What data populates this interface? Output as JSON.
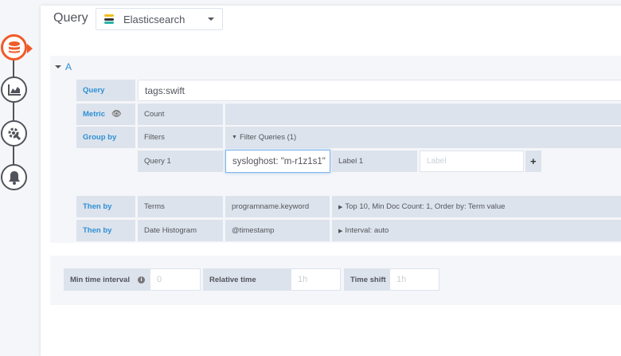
{
  "header": {
    "title": "Query",
    "datasource": "Elasticsearch"
  },
  "sidebar": {
    "icons": [
      "database-icon",
      "chart-area-icon",
      "settings-icon",
      "bell-icon"
    ],
    "accent": "#f05a28"
  },
  "query": {
    "ref": "A",
    "query_label": "Query",
    "query_value": "tags:swift",
    "metric_label": "Metric",
    "metric_value": "Count",
    "groupby_label": "Group by",
    "groupby_type": "Filters",
    "filter_queries": "Filter Queries (1)",
    "filter": {
      "label": "Query 1",
      "value": "sysloghost: \"m-r1z1s1\"",
      "label_label": "Label 1",
      "label_placeholder": "Label"
    },
    "then_by": [
      {
        "label": "Then by",
        "type": "Terms",
        "field": "programname.keyword",
        "options": "Top 10, Min Doc Count: 1, Order by: Term value"
      },
      {
        "label": "Then by",
        "type": "Date Histogram",
        "field": "@timestamp",
        "options": "Interval: auto"
      }
    ]
  },
  "options": {
    "min_interval_label": "Min time interval",
    "min_interval_placeholder": "0",
    "relative_label": "Relative time",
    "relative_placeholder": "1h",
    "shift_label": "Time shift",
    "shift_placeholder": "1h"
  }
}
